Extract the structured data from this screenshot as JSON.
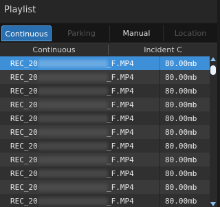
{
  "title": "Playlist",
  "tabs": [
    {
      "label": "Continuous",
      "state": "active"
    },
    {
      "label": "Parking",
      "state": "disabled"
    },
    {
      "label": "Manual",
      "state": "normal"
    },
    {
      "label": "Location",
      "state": "disabled"
    }
  ],
  "columns": [
    "Continuous",
    "Incident C"
  ],
  "rows": [
    {
      "prefix": "REC_20",
      "suffix": "_F.MP4",
      "size": "80.00mb",
      "selected": true
    },
    {
      "prefix": "REC_20",
      "suffix": "_F.MP4",
      "size": "80.00mb"
    },
    {
      "prefix": "REC_20",
      "suffix": "_F.MP4",
      "size": "80.00mb"
    },
    {
      "prefix": "REC_20",
      "suffix": "_F.MP4",
      "size": "80.00mb"
    },
    {
      "prefix": "REC_20",
      "suffix": "_F.MP4",
      "size": "80.00mb"
    },
    {
      "prefix": "REC_20",
      "suffix": "_F.MP4",
      "size": "80.00mb"
    },
    {
      "prefix": "REC_20",
      "suffix": "_F.MP4",
      "size": "80.00mb"
    },
    {
      "prefix": "REC_20",
      "suffix": "_F.MP4",
      "size": "80.00mb"
    },
    {
      "prefix": "REC_20",
      "suffix": "_F.MP4",
      "size": "80.00mb"
    },
    {
      "prefix": "REC_20",
      "suffix": "_F.MP4",
      "size": "80.00mb"
    },
    {
      "prefix": "REC_20",
      "suffix": "_F.MP4",
      "size": "80.00mb"
    }
  ],
  "colors": {
    "accent": "#3d8fd8",
    "active_tab": "#2a6fb0",
    "background": "#1e1e1e"
  },
  "icons": {
    "scroll_up": "triangle-up-icon",
    "scroll_down": "triangle-down-icon"
  }
}
